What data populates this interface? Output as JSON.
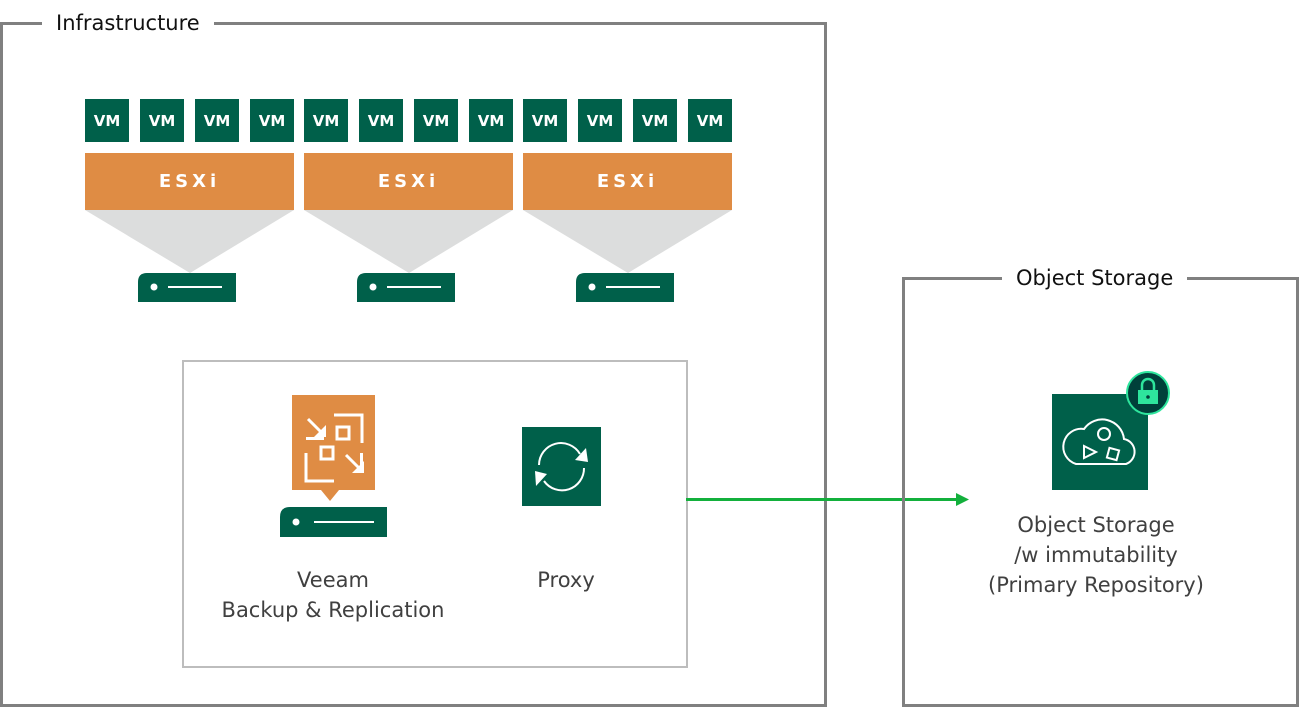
{
  "colors": {
    "vm_green": "#00604a",
    "esxi_orange": "#df8c44",
    "arrow_green": "#13b03c",
    "lock_accent": "#2ee59d",
    "frame_gray": "#808080"
  },
  "infrastructure": {
    "title": "Infrastructure",
    "hosts": [
      {
        "label": "ESXi",
        "vms": [
          "VM",
          "VM",
          "VM",
          "VM"
        ]
      },
      {
        "label": "ESXi",
        "vms": [
          "VM",
          "VM",
          "VM",
          "VM"
        ]
      },
      {
        "label": "ESXi",
        "vms": [
          "VM",
          "VM",
          "VM",
          "VM"
        ]
      }
    ],
    "backup_server": {
      "label_line1": "Veeam",
      "label_line2": "Backup & Replication",
      "icon": "veeam-backup-server-icon"
    },
    "proxy": {
      "label": "Proxy",
      "icon": "refresh-cycle-icon"
    }
  },
  "object_storage": {
    "title": "Object Storage",
    "repository": {
      "label_line1": "Object Storage",
      "label_line2": "/w immutability",
      "label_line3": "(Primary Repository)",
      "icon": "cloud-object-storage-icon",
      "badge": "lock-icon"
    }
  },
  "connections": [
    {
      "from": "infrastructure-inner-box",
      "to": "object-storage-repository",
      "type": "arrow"
    }
  ]
}
